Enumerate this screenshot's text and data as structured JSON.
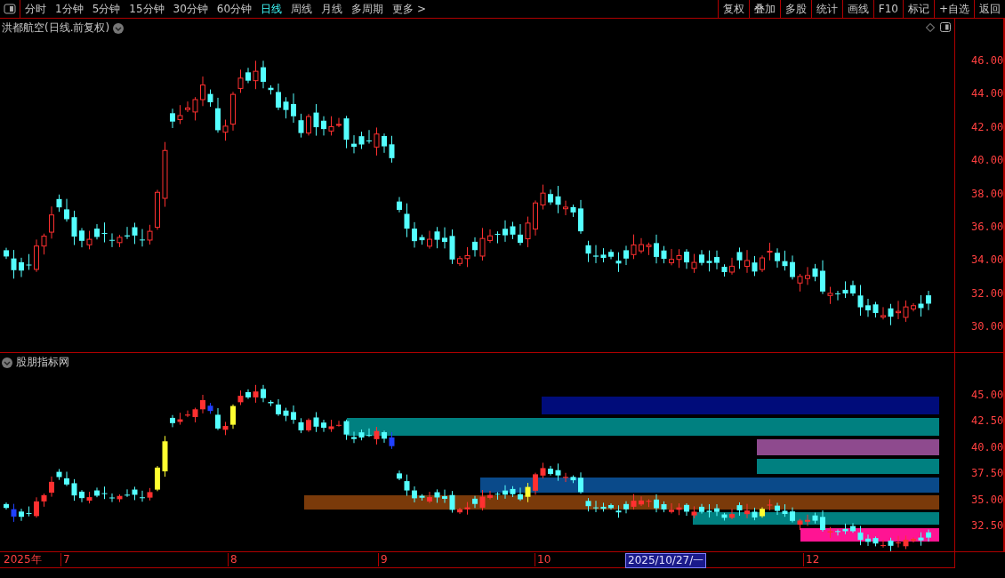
{
  "toolbar": {
    "periods": [
      {
        "label": "分时",
        "selected": false
      },
      {
        "label": "1分钟",
        "selected": false
      },
      {
        "label": "5分钟",
        "selected": false
      },
      {
        "label": "15分钟",
        "selected": false
      },
      {
        "label": "30分钟",
        "selected": false
      },
      {
        "label": "60分钟",
        "selected": false
      },
      {
        "label": "日线",
        "selected": true
      },
      {
        "label": "周线",
        "selected": false
      },
      {
        "label": "月线",
        "selected": false
      },
      {
        "label": "多周期",
        "selected": false
      },
      {
        "label": "更多 >",
        "selected": false
      }
    ],
    "actions": [
      "复权",
      "叠加",
      "多股",
      "统计",
      "画线",
      "F10",
      "标记",
      "+自选",
      "返回"
    ]
  },
  "price_panel": {
    "title": "洪都航空(日线.前复权)",
    "axis_ticks": [
      "46.00",
      "44.00",
      "42.00",
      "40.00",
      "38.00",
      "36.00",
      "34.00",
      "32.00",
      "30.00"
    ]
  },
  "indicator_panel": {
    "title": "股朋指标网",
    "axis_ticks": [
      "45.00",
      "42.50",
      "40.00",
      "37.50",
      "35.00",
      "32.50"
    ]
  },
  "date_axis": [
    {
      "label": "2025年",
      "kind": "year"
    },
    {
      "label": "7",
      "kind": "month"
    },
    {
      "label": "8",
      "kind": "month"
    },
    {
      "label": "9",
      "kind": "month"
    },
    {
      "label": "10",
      "kind": "month"
    },
    {
      "label": "2025/10/27/一",
      "kind": "cursor"
    },
    {
      "label": "12",
      "kind": "month"
    }
  ]
}
